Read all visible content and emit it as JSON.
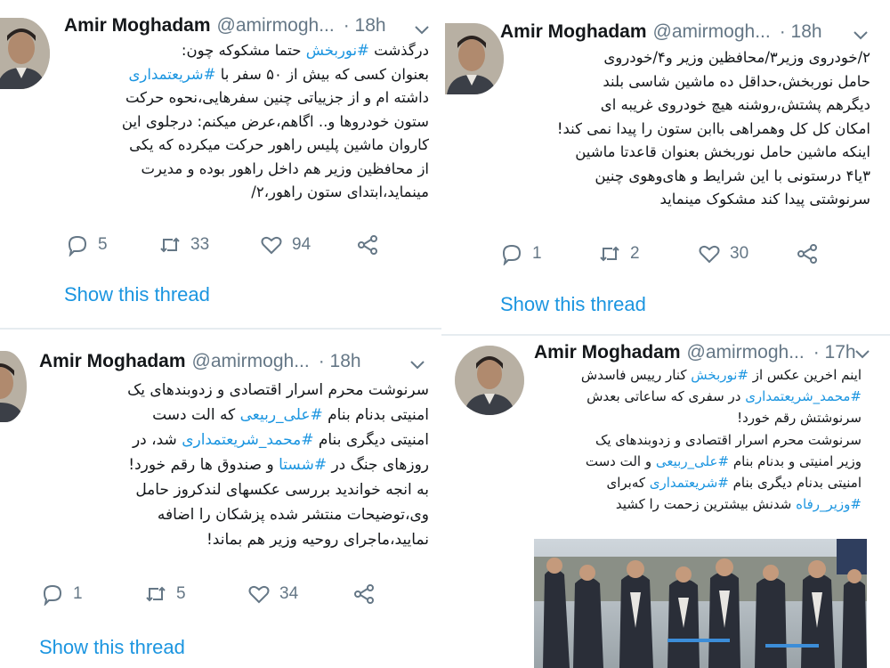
{
  "tweets": [
    {
      "author": "Amir Moghadam",
      "handle": "@amirmogh...",
      "separator": "·",
      "time": "18h",
      "lines": [
        [
          {
            "t": "درگذشت "
          },
          {
            "t": "#نوربخش",
            "tag": true
          },
          {
            "t": " حتما مشکوکه چون:"
          }
        ],
        [
          {
            "t": "بعنوان کسی که بیش از ۵۰ سفر با "
          },
          {
            "t": "#شریعتمداری",
            "tag": true
          }
        ],
        [
          {
            "t": "داشته ام و از جزییاتی چنین سفرهایی،نحوه حرکت"
          }
        ],
        [
          {
            "t": "ستون خودروها و.. اگاهم،عرض میکنم: درجلوی این"
          }
        ],
        [
          {
            "t": "کاروان ماشین پلیس راهور حرکت میکرده که یکی"
          }
        ],
        [
          {
            "t": "از محافظین وزیر هم داخل راهور بوده و مدیرت"
          }
        ],
        [
          {
            "t": "مینماید،ابتدای ستون راهور،۲/"
          }
        ]
      ],
      "replies": "5",
      "retweets": "33",
      "likes": "94",
      "show_thread": "Show this thread"
    },
    {
      "author": "Amir Moghadam",
      "handle": "@amirmogh...",
      "separator": "·",
      "time": "18h",
      "lines": [
        [
          {
            "t": "۲/خودروی وزیر۳/محافظین وزیر و۴/خودروی"
          }
        ],
        [
          {
            "t": "حامل نوربخش،حداقل ده ماشین شاسی بلند"
          }
        ],
        [
          {
            "t": "دیگرهم پشتش،روشنه هیچ خودروی غریبه ای"
          }
        ],
        [
          {
            "t": "امکان کل کل وهمراهی باابن ستون را پیدا نمی کند!"
          }
        ],
        [
          {
            "t": "اینکه ماشین حامل نوربخش بعنوان قاعدتا ماشین"
          }
        ],
        [
          {
            "t": "۳یا۴ درستونی با این شرایط و های‌وهوی چنین"
          }
        ],
        [
          {
            "t": "سرنوشتی پیدا کند مشکوک مینماید"
          }
        ]
      ],
      "replies": "1",
      "retweets": "2",
      "likes": "30",
      "show_thread": "Show this thread"
    },
    {
      "author": "Amir Moghadam",
      "handle": "@amirmogh...",
      "separator": "·",
      "time": "18h",
      "lines": [
        [
          {
            "t": "سرنوشت محرم اسرار اقتصادی و زدوبندهای یک"
          }
        ],
        [
          {
            "t": "امنیتی بدنام بنام "
          },
          {
            "t": "#علی_ربیعی",
            "tag": true
          },
          {
            "t": " که الت دست"
          }
        ],
        [
          {
            "t": "امنیتی دیگری بنام "
          },
          {
            "t": "#محمد_شریعتمداری",
            "tag": true
          },
          {
            "t": " شد، در"
          }
        ],
        [
          {
            "t": "روزهای جنگ در "
          },
          {
            "t": "#شستا",
            "tag": true
          },
          {
            "t": " و صندوق ها رقم خورد!"
          }
        ],
        [
          {
            "t": "به انجه خواندید بررسی عکسهای لندکروز حامل"
          }
        ],
        [
          {
            "t": "وی،توضیحات منتشر شده پزشکان را اضافه"
          }
        ],
        [
          {
            "t": "نمایید،ماجرای روحیه وزیر هم بماند!"
          }
        ]
      ],
      "replies": "1",
      "retweets": "5",
      "likes": "34",
      "show_thread": "Show this thread"
    },
    {
      "author": "Amir Moghadam",
      "handle": "@amirmogh...",
      "separator": "·",
      "time": "17h",
      "lines": [
        [
          {
            "t": "اینم اخرین عکس از "
          },
          {
            "t": "#نوربخش",
            "tag": true
          },
          {
            "t": " کنار رییس فاسدش"
          }
        ],
        [
          {
            "t": "#محمد_شریعتمداری",
            "tag": true
          },
          {
            "t": " در سفری که ساعاتی بعدش"
          }
        ],
        [
          {
            "t": "سرنوشتش رقم خورد!"
          }
        ],
        [
          {
            "t": "سرنوشت محرم اسرار اقتصادی و زدوبندهای یک"
          }
        ],
        [
          {
            "t": "وزیر امنیتی و بدنام بنام "
          },
          {
            "t": "#علی_ربیعی",
            "tag": true
          },
          {
            "t": " و الت دست"
          }
        ],
        [
          {
            "t": "امنیتی بدنام دیگری بنام "
          },
          {
            "t": "#شریعتمداری",
            "tag": true
          },
          {
            "t": " که‌برای"
          }
        ],
        [
          {
            "t": "#وزیر_رفاه",
            "tag": true
          },
          {
            "t": " شدنش بیشترین زحمت را کشید"
          }
        ]
      ],
      "photo_alt": "group photo"
    }
  ],
  "icons": {
    "reply": "reply-icon",
    "retweet": "retweet-icon",
    "like": "heart-icon",
    "share": "share-icon",
    "caret": "chevron-down-icon"
  },
  "colors": {
    "link": "#1b95e0",
    "meta": "#657786",
    "divider": "#e6ecf0"
  }
}
